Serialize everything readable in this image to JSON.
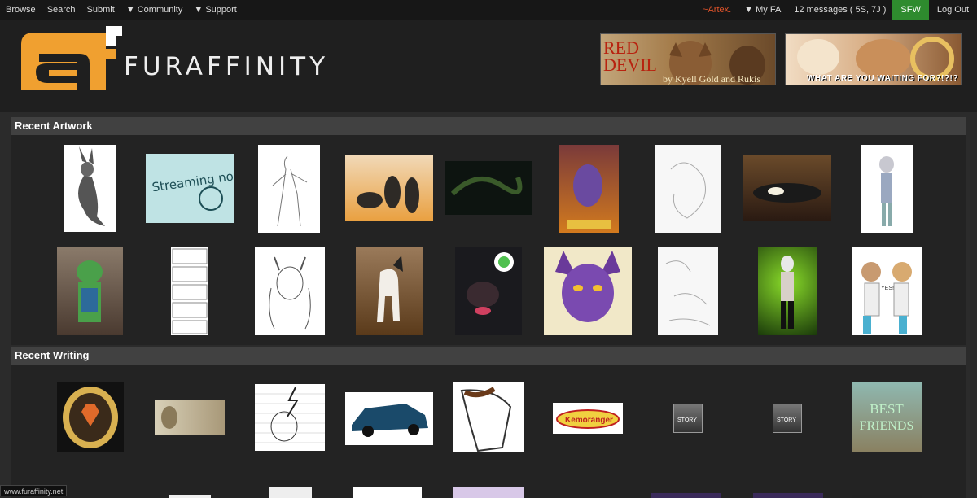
{
  "nav": {
    "left": [
      "Browse",
      "Search",
      "Submit",
      "▼ Community",
      "▼ Support"
    ],
    "user": "~Artex.",
    "myfa": "▼ My FA",
    "messages": "12 messages ( 5S, 7J )",
    "sfw": "SFW",
    "logout": "Log Out"
  },
  "header": {
    "logo_text": "FURAFFINITY",
    "banner1_title": "RED DEVIL",
    "banner1_line1": "RED",
    "banner1_line2": "DEVIL",
    "banner1_byline": "by Kyell Gold and Rukis",
    "banner2_text": "WHAT ARE YOU WAITING FOR?!?!?"
  },
  "sections": {
    "artwork_title": "Recent Artwork",
    "writing_title": "Recent Writing"
  },
  "writing_labels": {
    "story1": "STORY",
    "story2": "STORY",
    "best_friends_1": "BEST",
    "best_friends_2": "FRIENDS",
    "kemoranger": "Kemoranger"
  },
  "thumb_text": {
    "streaming": "Streaming now!",
    "yes": "YES!"
  },
  "footer": {
    "url": "www.furaffinity.net"
  },
  "colors": {
    "accent": "#f0a030",
    "sfw_green": "#2e8b2e",
    "user_orange": "#e0532a"
  }
}
